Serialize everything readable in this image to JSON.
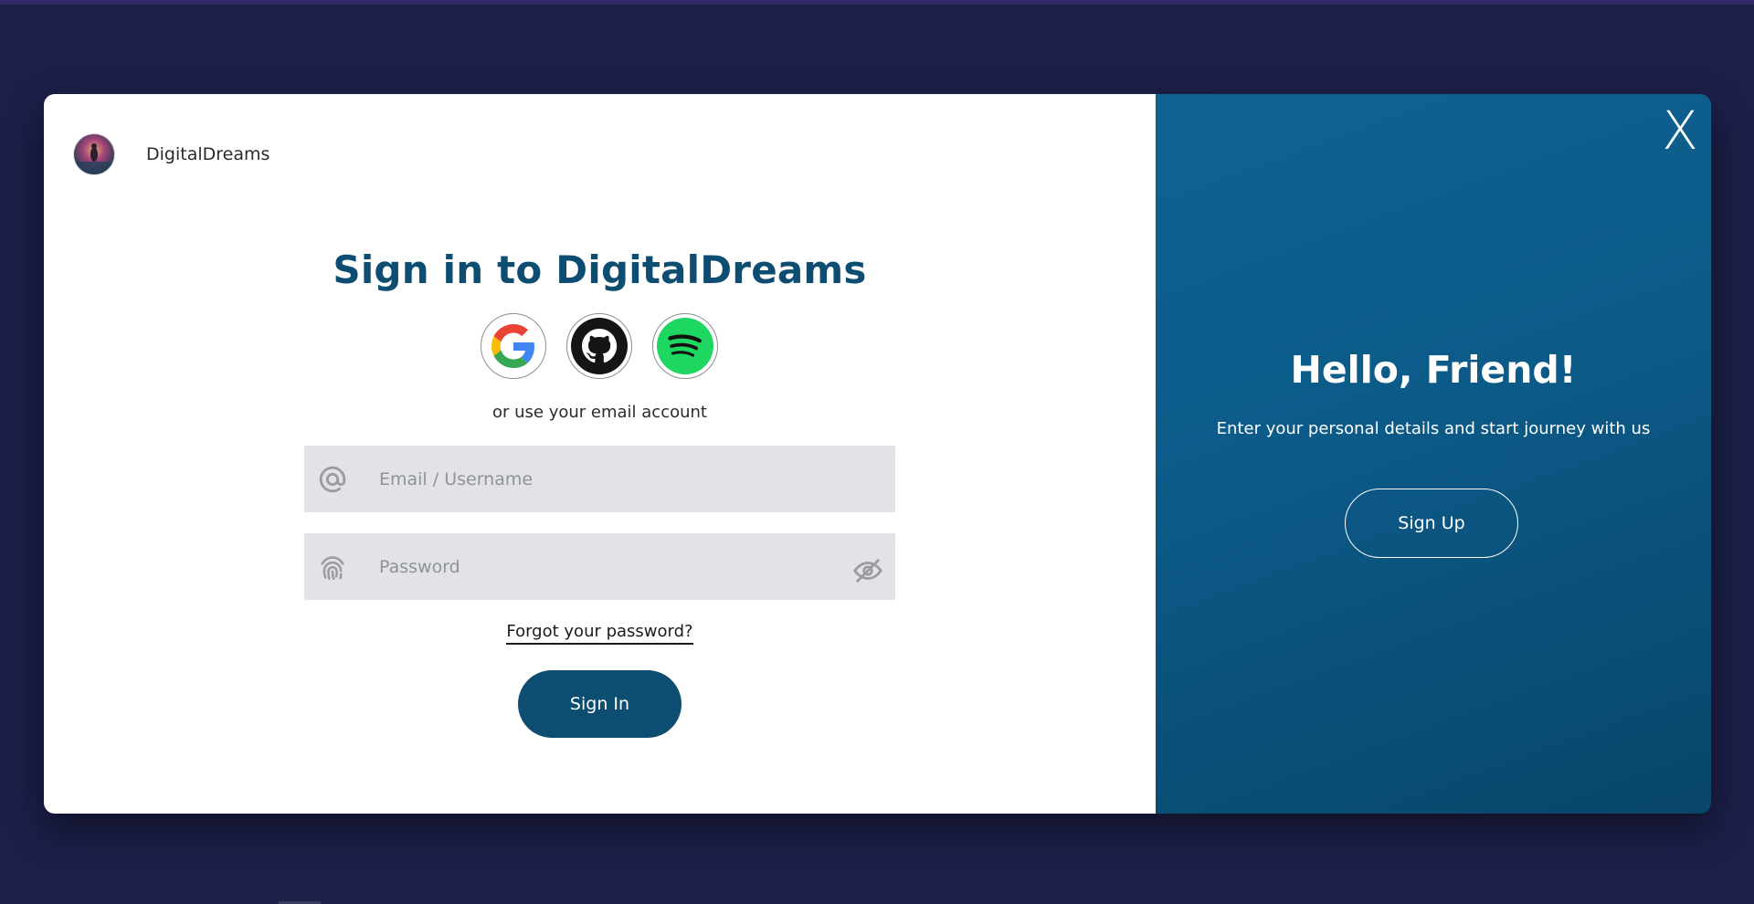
{
  "brand": {
    "name": "DigitalDreams",
    "logo_icon": "avatar-icon"
  },
  "signin": {
    "title": "Sign in to DigitalDreams",
    "social": [
      {
        "name": "google",
        "icon": "google-icon"
      },
      {
        "name": "github",
        "icon": "github-icon"
      },
      {
        "name": "spotify",
        "icon": "spotify-icon"
      }
    ],
    "or_text": "or use your email account",
    "email_placeholder": "Email / Username",
    "password_placeholder": "Password",
    "forgot": "Forgot your password?",
    "button": "Sign In"
  },
  "welcome": {
    "close": "X",
    "title": "Hello, Friend!",
    "subtitle": "Enter your personal details and start journey with us",
    "button": "Sign Up"
  },
  "colors": {
    "page_bg": "#1c1f48",
    "primary": "#0e4d72",
    "panel_gradient_start": "#0e6394",
    "panel_gradient_end": "#084669",
    "field_bg": "#e2e3e6"
  }
}
